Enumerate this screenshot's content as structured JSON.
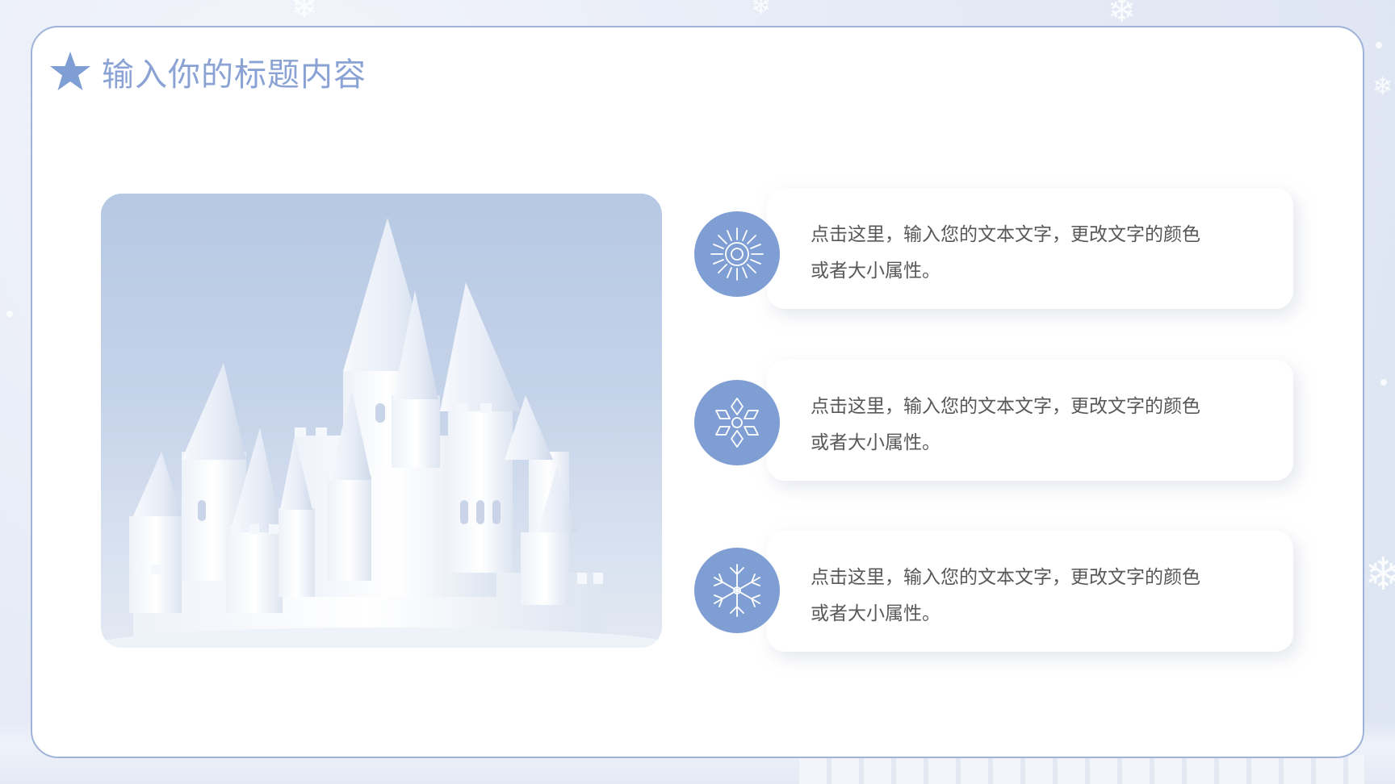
{
  "slide": {
    "title": "输入你的标题内容",
    "title_icon": "star-icon",
    "accent_color": "#7f9ed4",
    "title_color": "#8aa3d4",
    "border_color": "#9fb3da"
  },
  "image": {
    "subject": "snow-castle-photo"
  },
  "items": [
    {
      "icon": "sun-snowflake-icon",
      "line1": "点击这里，输入您的文本文字，更改文字的颜色",
      "line2": "或者大小属性。"
    },
    {
      "icon": "flower-snowflake-icon",
      "line1": "点击这里，输入您的文本文字，更改文字的颜色",
      "line2": "或者大小属性。"
    },
    {
      "icon": "crystal-snowflake-icon",
      "line1": "点击这里，输入您的文本文字，更改文字的颜色",
      "line2": "或者大小属性。"
    }
  ]
}
